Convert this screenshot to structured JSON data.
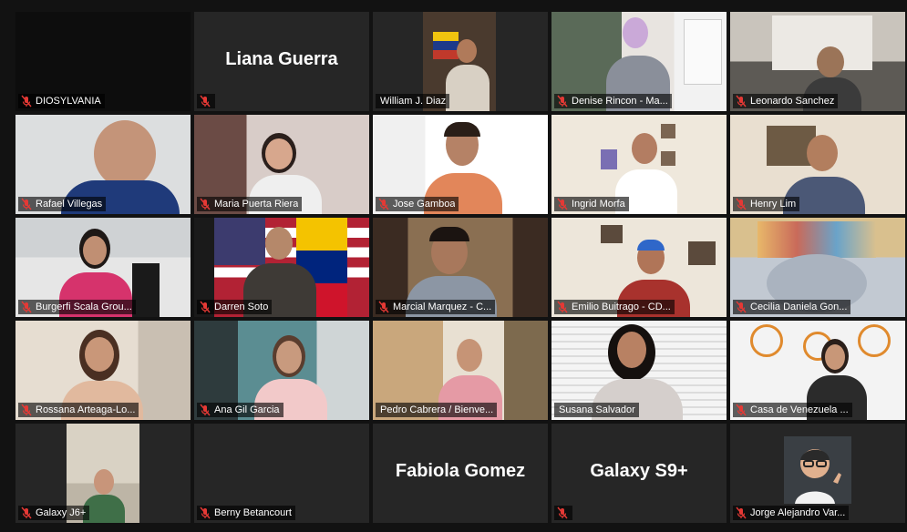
{
  "meeting": {
    "participants": [
      {
        "name": "DIOSYLVANIA",
        "muted": true,
        "video": "off"
      },
      {
        "name": "",
        "display_name": "Liana Guerra",
        "muted": true,
        "video": "off"
      },
      {
        "name": "William J. Diaz",
        "muted": false,
        "video": "on",
        "active_speaker": true
      },
      {
        "name": "Denise Rincon - Ma...",
        "muted": true,
        "video": "on"
      },
      {
        "name": "Leonardo Sanchez",
        "muted": true,
        "video": "on"
      },
      {
        "name": "Rafael Villegas",
        "muted": true,
        "video": "on"
      },
      {
        "name": "Maria Puerta Riera",
        "muted": true,
        "video": "on"
      },
      {
        "name": "Jose Gamboa",
        "muted": true,
        "video": "on"
      },
      {
        "name": "Ingrid Morfa",
        "muted": true,
        "video": "on"
      },
      {
        "name": "Henry Lim",
        "muted": true,
        "video": "on"
      },
      {
        "name": "Burgerfi Scala Grou...",
        "muted": true,
        "video": "on"
      },
      {
        "name": "Darren Soto",
        "muted": true,
        "video": "on"
      },
      {
        "name": "Marcial Marquez - C...",
        "muted": true,
        "video": "on"
      },
      {
        "name": "Emilio Buitrago - CD...",
        "muted": true,
        "video": "on"
      },
      {
        "name": "Cecilia Daniela Gon...",
        "muted": true,
        "video": "on"
      },
      {
        "name": "Rossana Arteaga-Lo...",
        "muted": true,
        "video": "on"
      },
      {
        "name": "Ana Gil Garcia",
        "muted": true,
        "video": "on"
      },
      {
        "name": "Pedro Cabrera / Bienve...",
        "muted": false,
        "video": "on"
      },
      {
        "name": "Susana Salvador",
        "muted": false,
        "video": "on"
      },
      {
        "name": "Casa de Venezuela ...",
        "muted": true,
        "video": "on"
      },
      {
        "name": "Galaxy J6+",
        "muted": true,
        "video": "on"
      },
      {
        "name": "Berny Betancourt",
        "muted": true,
        "video": "off"
      },
      {
        "name": "",
        "display_name": "Fabiola Gomez",
        "muted": false,
        "video": "off",
        "no_nameplate": true
      },
      {
        "name": "",
        "display_name": "Galaxy S9+",
        "muted": true,
        "video": "off"
      },
      {
        "name": "Jorge Alejandro Var...",
        "muted": true,
        "video": "avatar"
      }
    ]
  },
  "colors": {
    "active_speaker_border": "#d4e157",
    "muted_icon": "#e53935",
    "tile_background": "#262626",
    "page_background": "#121212"
  },
  "icons": {
    "muted": "microphone-muted-icon"
  }
}
